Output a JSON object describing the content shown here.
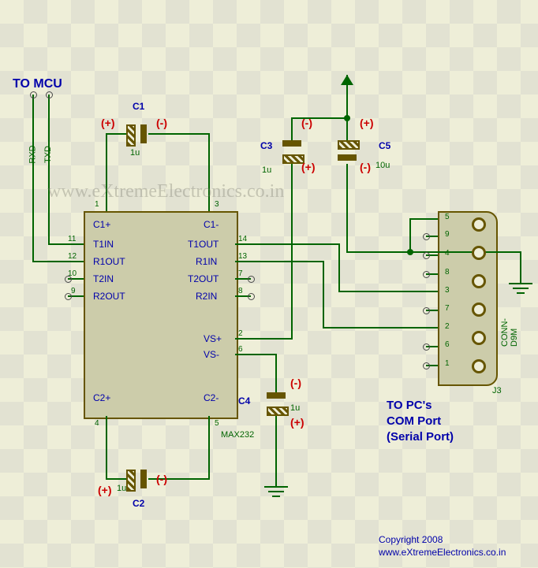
{
  "title": "TO MCU",
  "mcu_signals": {
    "rxd": "RXD",
    "txd": "TXD"
  },
  "ic": {
    "name": "MAX232",
    "pins_left": {
      "p1": "C1+",
      "p11": "T1IN",
      "p12": "R1OUT",
      "p10": "T2IN",
      "p9": "R2OUT",
      "p4": "C2+"
    },
    "pins_right": {
      "p3": "C1-",
      "p14": "T1OUT",
      "p13": "R1IN",
      "p7": "T2OUT",
      "p8": "R2IN",
      "p2": "VS+",
      "p6": "VS-",
      "p5": "C2-"
    },
    "numbers_left": [
      "1",
      "11",
      "12",
      "10",
      "9",
      "4"
    ],
    "numbers_right": [
      "3",
      "14",
      "13",
      "7",
      "8",
      "2",
      "6",
      "5"
    ]
  },
  "caps": {
    "C1": {
      "label": "C1",
      "value": "1u"
    },
    "C2": {
      "label": "C2",
      "value": "1u"
    },
    "C3": {
      "label": "C3",
      "value": "1u"
    },
    "C4": {
      "label": "C4",
      "value": "1u"
    },
    "C5": {
      "label": "C5",
      "value": "10u"
    }
  },
  "polarity": {
    "plus": "(+)",
    "minus": "(-)"
  },
  "connector": {
    "label_line1": "TO PC's",
    "label_line2": "COM Port",
    "label_line3": "(Serial Port)",
    "ref": "J3",
    "type": "CONN-D9M",
    "pins": [
      "5",
      "9",
      "4",
      "8",
      "3",
      "7",
      "2",
      "6",
      "1"
    ]
  },
  "watermark": "www.eXtremeElectronics.co.in",
  "copyright": {
    "line1": "Copyright 2008",
    "line2": "www.eXtremeElectronics.co.in"
  },
  "chart_data": {
    "type": "schematic",
    "ic": "MAX232",
    "capacitors": [
      {
        "ref": "C1",
        "value": "1u",
        "between": [
          "C1+",
          "C1-"
        ]
      },
      {
        "ref": "C2",
        "value": "1u",
        "between": [
          "C2+",
          "C2-"
        ]
      },
      {
        "ref": "C3",
        "value": "1u",
        "between": [
          "VS+",
          "VCC_arrow"
        ]
      },
      {
        "ref": "C4",
        "value": "1u",
        "between": [
          "VS-",
          "GND"
        ]
      },
      {
        "ref": "C5",
        "value": "10u",
        "between": [
          "VCC_arrow",
          "GND"
        ]
      }
    ],
    "connections": [
      {
        "from": "MCU.TXD",
        "to": "MAX232.T1IN(11)"
      },
      {
        "from": "MCU.RXD",
        "to": "MAX232.R1OUT(12)"
      },
      {
        "from": "MAX232.T1OUT(14)",
        "to": "J3.pin3"
      },
      {
        "from": "MAX232.R1IN(13)",
        "to": "J3.pin2"
      },
      {
        "from": "J3.pin5",
        "to": "GND"
      }
    ],
    "connector": {
      "ref": "J3",
      "type": "CONN-D9M",
      "pins": 9
    }
  }
}
